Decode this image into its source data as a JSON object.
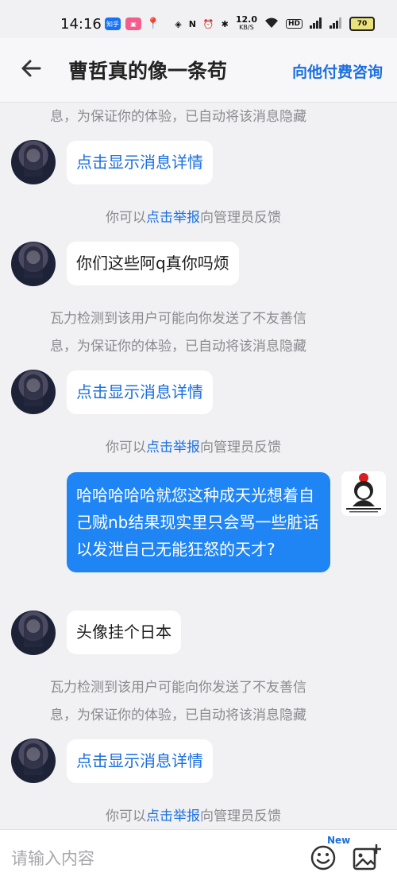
{
  "status_bar": {
    "time": "14:16",
    "net_speed": "12.0",
    "net_unit": "KB/S",
    "battery": "70"
  },
  "header": {
    "title": "曹哲真的像一条苟",
    "pay_consult": "向他付费咨询"
  },
  "messages": {
    "sys_top": "息，为保证你的体验，已自动将该消息隐藏",
    "show_detail_1": "点击显示消息详情",
    "report_1_pre": "你可以",
    "report_1_link": "点击举报",
    "report_1_post": "向管理员反馈",
    "msg_1": "你们这些阿q真你吗烦",
    "sys_warn_2a": "瓦力检测到该用户可能向你发送了不友善信",
    "sys_warn_2b": "息，为保证你的体验，已自动将该消息隐藏",
    "show_detail_2": "点击显示消息详情",
    "report_2_pre": "你可以",
    "report_2_link": "点击举报",
    "report_2_post": "向管理员反馈",
    "own_msg": "哈哈哈哈哈就您这种成天光想着自己贼nb结果现实里只会骂一些脏话以发泄自己无能狂怒的天才?",
    "msg_2": "头像挂个日本",
    "sys_warn_3a": "瓦力检测到该用户可能向你发送了不友善信",
    "sys_warn_3b": "息，为保证你的体验，已自动将该消息隐藏",
    "show_detail_3": "点击显示消息详情",
    "report_3_pre": "你可以",
    "report_3_link": "点击举报",
    "report_3_post": "向管理员反馈"
  },
  "input": {
    "placeholder": "请输入内容",
    "new_badge": "New"
  },
  "colors": {
    "accent": "#1b6fe0",
    "own_bubble": "#1f85f5",
    "background": "#f1f1f3"
  }
}
